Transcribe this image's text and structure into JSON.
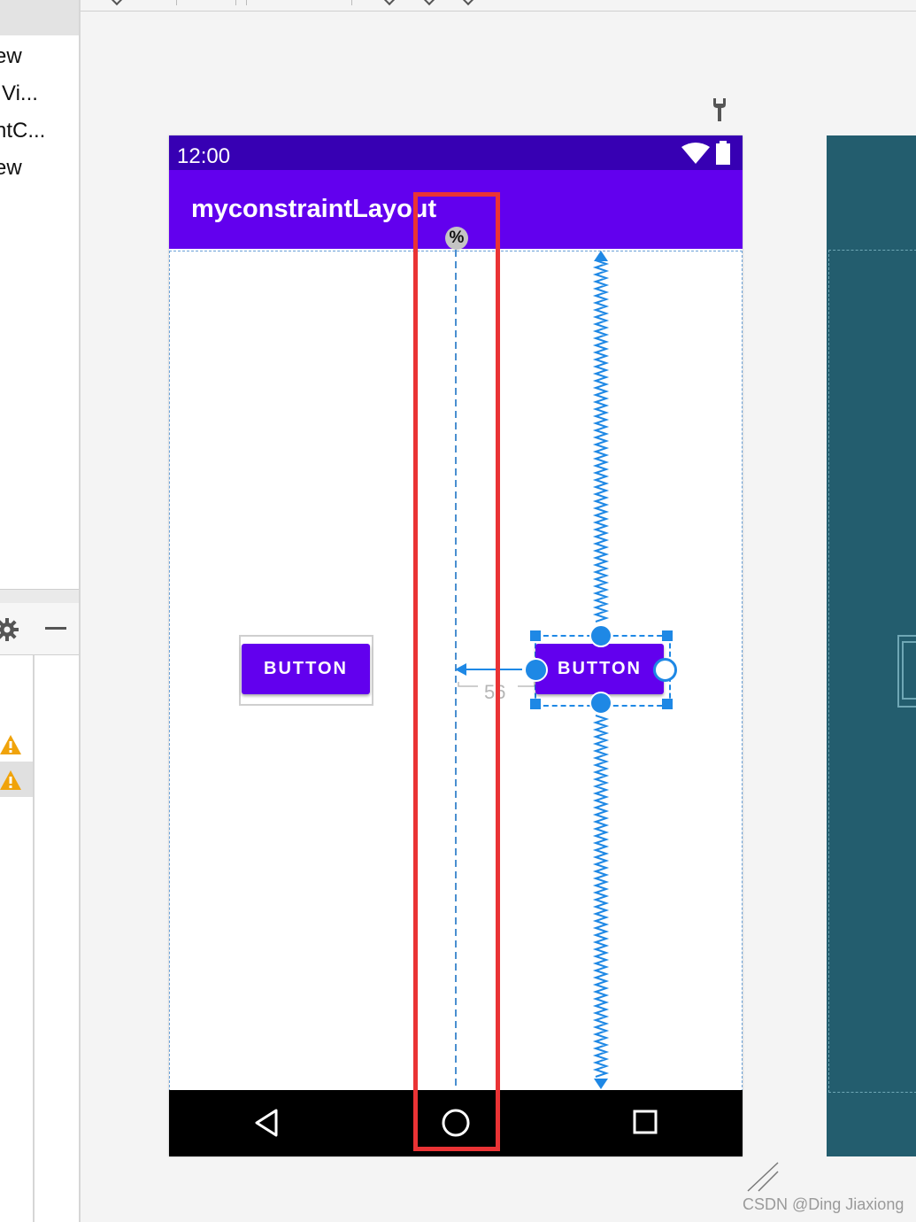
{
  "left_panel": {
    "tree_items": [
      "ew",
      "·Vi...",
      "ntC...",
      "ew"
    ]
  },
  "device": {
    "status_time": "12:00",
    "app_title": "myconstraintLayout",
    "button1_label": "BUTTON",
    "button2_label": "BUTTON",
    "guideline_badge": "%",
    "margin_value": "56"
  },
  "watermark": "CSDN @Ding Jiaxiong",
  "colors": {
    "status_bar": "#3700b3",
    "app_bar": "#6200ee",
    "button": "#6200ee",
    "constraint_blue": "#1e88e5",
    "highlight": "#ea3335",
    "blueprint": "#235d6e"
  },
  "icons": [
    "wifi-icon",
    "battery-icon",
    "back-icon",
    "home-icon",
    "recents-icon",
    "wrench-icon",
    "gear-icon",
    "minus-icon",
    "warning-icon",
    "resize-handle-icon"
  ]
}
